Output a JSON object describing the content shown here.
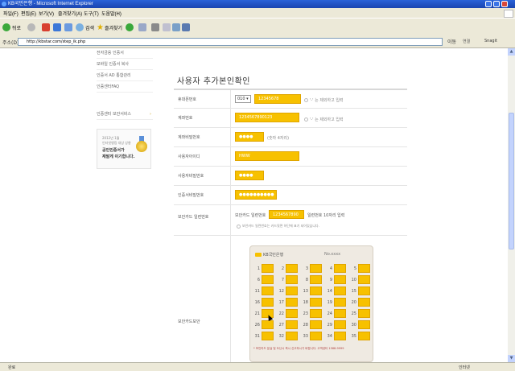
{
  "window": {
    "title": "KB국민은행 - Microsoft Internet Explorer",
    "buttons": [
      "minimize",
      "maximize",
      "close"
    ]
  },
  "menubar": {
    "items": [
      "파일(F)",
      "편집(E)",
      "보기(V)",
      "즐겨찾기(A)",
      "도구(T)",
      "도움말(H)"
    ]
  },
  "toolbar": {
    "back_label": "뒤로",
    "search_label": "검색",
    "favorites_label": "즐겨찾기",
    "icons": [
      "back-icon",
      "forward-icon",
      "stop-icon",
      "refresh-icon",
      "home-icon",
      "search-icon",
      "favorites-icon",
      "media-icon",
      "mail-icon",
      "print-icon",
      "edit-icon",
      "messenger-icon"
    ]
  },
  "addressbar": {
    "label": "주소(D)",
    "url": "http://kbstar.com/step_ik.php",
    "go_label": "이동",
    "links_label": "연결",
    "snagit_label": "Snagit"
  },
  "sidebar": {
    "items": [
      {
        "label": "전자금융 인증서"
      },
      {
        "label": "모바일 인증서 복사"
      },
      {
        "label": "인증서 AD 통합관리"
      },
      {
        "label": "인증센터FAQ"
      },
      {
        "label": "인증센터 보안서비스"
      }
    ],
    "banner": {
      "line1": "2012년 1월",
      "line2": "인터넷뱅킹 대상 상향",
      "line3": "공인인증서가",
      "line4": "재발게 이기합니다."
    }
  },
  "form": {
    "title": "사용자 추가본인확인",
    "rows": [
      {
        "label": "휴대폰번호",
        "select": "010",
        "value": "12345678",
        "note": "'-' 는 제외하고 입력"
      },
      {
        "label": "계좌번호",
        "value": "1234567890123",
        "note": "'-' 는 제외하고 입력"
      },
      {
        "label": "계좌비밀번호",
        "value": "●●●●",
        "note": "(숫자 4자리)"
      },
      {
        "label": "사용자아이디",
        "value": "HWW"
      },
      {
        "label": "사용자비밀번호",
        "value": "●●●●"
      },
      {
        "label": "인증서비밀번호",
        "value": "●●●●●●●●●●"
      },
      {
        "label": "보안카드 일련번호",
        "prefix": "보안카드 일련번호",
        "value": "1234567890",
        "suffix": "일련번호 10자리 입력",
        "note": "보안카드 일련번호는 카드뒷면 하단에 표기 되어있습니다."
      },
      {
        "label": "보안카드보안"
      }
    ]
  },
  "security_card": {
    "bank": "KB국민은행",
    "number_label": "No.xxxx",
    "cells": [
      "1",
      "2",
      "3",
      "4",
      "5",
      "6",
      "7",
      "8",
      "9",
      "10",
      "11",
      "12",
      "13",
      "14",
      "15",
      "16",
      "17",
      "18",
      "19",
      "20",
      "21",
      "22",
      "23",
      "24",
      "25",
      "26",
      "27",
      "28",
      "29",
      "30",
      "31",
      "32",
      "33",
      "34",
      "35"
    ],
    "footer": "* 보안카드 분실 및 도난시 즉시 신고하시기 바랍니다. 고객센터 1588-9999"
  },
  "statusbar": {
    "status": "완료",
    "zone": "인터넷"
  },
  "colors": {
    "accent": "#f7c100",
    "titlebar": "#2a62d8",
    "chrome": "#ece9d8"
  }
}
